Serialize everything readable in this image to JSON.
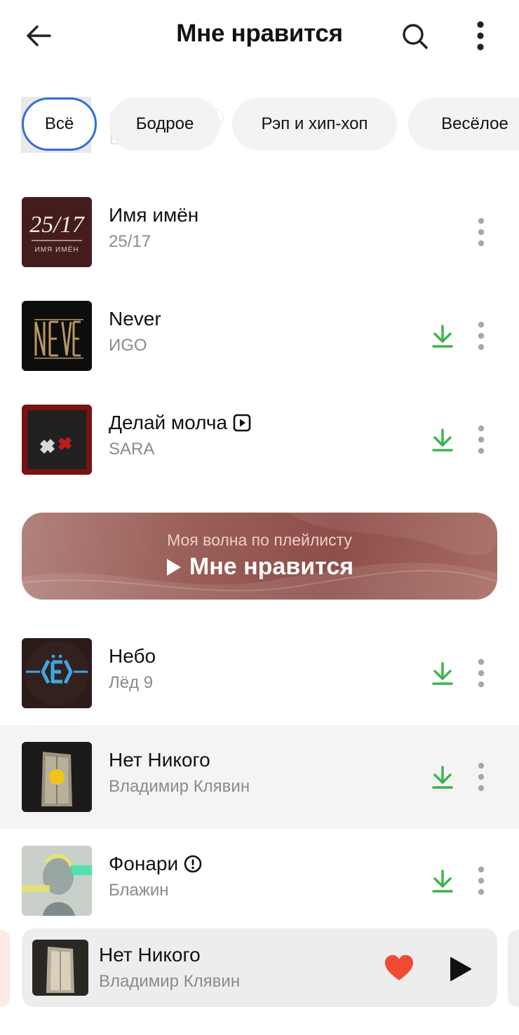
{
  "header": {
    "title": "Мне нравится",
    "back_icon": "arrow-left-icon",
    "search_icon": "search-icon",
    "more_icon": "more-vertical-icon"
  },
  "ghost": {
    "title": "Кукла вуду ⓘ",
    "artist": "Ы Маше"
  },
  "filters": [
    {
      "label": "Всё",
      "active": true
    },
    {
      "label": "Бодрое",
      "active": false
    },
    {
      "label": "Рэп и хип-хоп",
      "active": false
    },
    {
      "label": "Весёлое",
      "active": false
    }
  ],
  "tracks_top": [
    {
      "title": "Имя имён",
      "artist": "25/17",
      "downloaded": false,
      "cover_text": "25/17",
      "cover_sub": "ИМЯ ИМЁН"
    },
    {
      "title": "Never",
      "artist": "ИGO",
      "downloaded": true,
      "cover_text": "NEVER"
    },
    {
      "title": "Делай молча",
      "artist": "SARA",
      "downloaded": true,
      "badge_icon": "video-clip-icon"
    }
  ],
  "wave": {
    "subtitle": "Моя волна по плейлисту",
    "title": "Мне нравится"
  },
  "tracks_bottom": [
    {
      "title": "Небо",
      "artist": "Лёд 9",
      "downloaded": true
    },
    {
      "title": "Нет Никого",
      "artist": "Владимир Клявин",
      "downloaded": true,
      "highlighted": true
    },
    {
      "title": "Фонари",
      "artist": "Блажин",
      "downloaded": true,
      "badge_icon": "explicit-icon"
    }
  ],
  "player": {
    "title": "Нет Никого",
    "artist": "Владимир Клявин",
    "liked": true
  },
  "colors": {
    "accent_blue": "#2f6fd6",
    "download_green": "#3cb44b",
    "like_red": "#f04a32"
  }
}
